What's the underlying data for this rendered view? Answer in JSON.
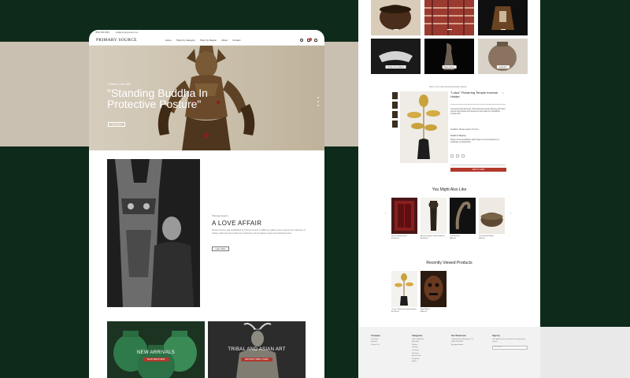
{
  "left": {
    "topbar": {
      "phone": "(555) 555-5555",
      "email": "info@primarysource.com"
    },
    "brand": "PRIMARY SOURCE",
    "menu": [
      "Home",
      "Shop by Category",
      "Shop by Region",
      "About",
      "Contact"
    ],
    "cart_count": "0",
    "hero": {
      "subtitle": "Thailand, Circa 1800",
      "title": "\"Standing Buddha In Protective Posture\"",
      "button": "Shop Now"
    },
    "story": {
      "tag": "Thomas Guerin",
      "title": "A LOVE AFFAIR",
      "text": "Primary Source was established by Thomas Guerin in 1986 as a gallery and a resource for collectors of antique tribal arts and textiles from Indonesia, the Himalayan region and Southeast Asia.",
      "button": "Learn More"
    },
    "tiles": [
      {
        "title": "NEW ARRIVALS",
        "button": "SHOP NEW ITEMS"
      },
      {
        "kicker": "Shop",
        "title": "TRIBAL AND ASIAN ART",
        "button": "BROWSE TRIBAL ITEMS"
      }
    ]
  },
  "right": {
    "gallery": [
      {
        "label": ""
      },
      {
        "label": ""
      },
      {
        "label": ""
      },
      {
        "label": "Tribal Art & Artifacts"
      },
      {
        "label": "Rare & Fine"
      },
      {
        "label": "Ceramics"
      }
    ],
    "breadcrumb": "Home / Art / Lotus Flowering Temple Incense",
    "product": {
      "title": "\"Lotus\" Flowering Temple Incense Holder",
      "description": "Lacquered and gilt wood. This flowering temple offering with hand carved lotus leaves and blossoms was made for a Buddhist temple altar.",
      "price_note": "Available. Please inquire for price.",
      "details_heading": "Details & Shipping",
      "details_text": "Ships insured worldwide. Each object is accompanied by a certificate of authenticity.",
      "add_to_cart": "ADD TO CART"
    },
    "you_might_like": {
      "title": "You Might Also Like",
      "items": [
        {
          "name": "Set of Temple Doors",
          "price": "$2,400.00"
        },
        {
          "name": "Ancestor Figure with Headdress",
          "price": "$1,800.00"
        },
        {
          "name": "Carved Hook",
          "price": "$650.00"
        },
        {
          "name": "Carved Wood Bowl",
          "price": "$420.00"
        }
      ]
    },
    "recently_viewed": {
      "title": "Recently Viewed Products",
      "items": [
        {
          "name": "\"Lotus\" Flowering Temple Holder",
          "price": "$1,250.00"
        },
        {
          "name": "Nepal Mask",
          "price": "$900.00"
        }
      ]
    },
    "footer": {
      "col1": {
        "heading": "Company",
        "links": [
          "Our Story",
          "Reviews",
          "Contact Us"
        ]
      },
      "col2": {
        "heading": "Categories",
        "links": [
          "Tribal & Artifacts",
          "Asian Art",
          "Textiles",
          "Jewelry",
          "Ceramics",
          "Furniture",
          "Rare & Fine",
          "Sculpture",
          "Masks"
        ]
      },
      "col3": {
        "heading": "Our Showroom",
        "address": "1 Main Street, Burlington, VT",
        "phone": "(555) 555-5555",
        "hours": "By appointment"
      },
      "col4": {
        "heading": "Sign Up",
        "text": "Get updates on new arrivals and upcoming events.",
        "placeholder": "Your Email"
      }
    }
  },
  "colors": {
    "background": "#0e2a1b",
    "accent": "#b3382c",
    "hero_band": "#c9c0b1"
  },
  "icons": [
    "search-icon",
    "cart-icon",
    "user-icon",
    "heart-icon",
    "arrow-left-icon",
    "arrow-right-icon"
  ]
}
